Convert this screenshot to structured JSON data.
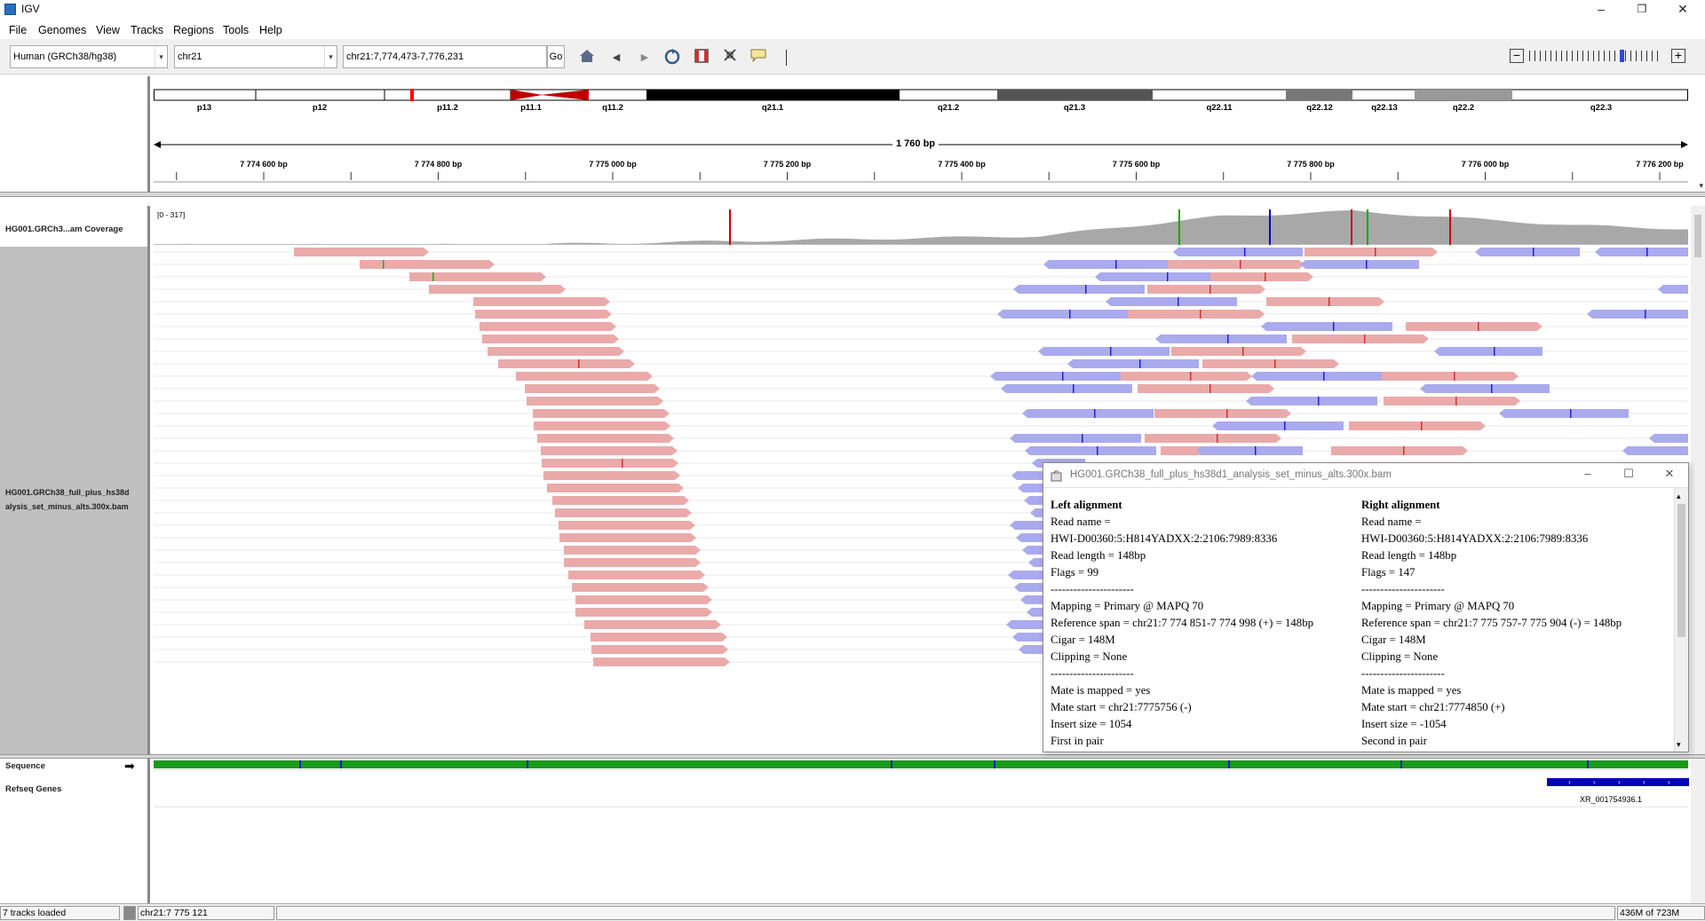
{
  "window": {
    "title": "IGV",
    "minimize": "–",
    "maximize": "❐",
    "close": "✕"
  },
  "menu": [
    "File",
    "Genomes",
    "View",
    "Tracks",
    "Regions",
    "Tools",
    "Help"
  ],
  "toolbar": {
    "genome": "Human (GRCh38/hg38)",
    "chromosome": "chr21",
    "locus": "chr21:7,774,473-7,776,231",
    "go_label": "Go",
    "icons": [
      "home-icon",
      "back-icon",
      "forward-icon",
      "refresh-icon",
      "roi-icon",
      "resize-icon",
      "popup-text-icon"
    ],
    "zoom_out": "−",
    "zoom_in": "+",
    "zoom_level_fraction": 0.68
  },
  "ideogram": {
    "bands": [
      "p13",
      "p12",
      "p11.2",
      "p11.1",
      "q11.2",
      "q21.1",
      "q21.2",
      "q21.3",
      "q22.11",
      "q22.12",
      "q22.13",
      "q22.2",
      "q22.3"
    ]
  },
  "ruler": {
    "span_label": "1 760 bp",
    "ticks": [
      "7 774 600 bp",
      "7 774 800 bp",
      "7 775 000 bp",
      "7 775 200 bp",
      "7 775 400 bp",
      "7 775 600 bp",
      "7 775 800 bp",
      "7 776 000 bp",
      "7 776 200 bp"
    ]
  },
  "tracks": {
    "coverage_name": "HG001.GRCh3...am Coverage",
    "coverage_range": "[0 - 317]",
    "alignment_name_line1": "HG001.GRCh38_full_plus_hs38d",
    "alignment_name_line2": "alysis_set_minus_alts.300x.bam",
    "sequence_name": "Sequence",
    "sequence_arrow": "➡",
    "refseq_name": "Refseq Genes",
    "gene_label": "XR_001754936.1"
  },
  "popup": {
    "title": "HG001.GRCh38_full_plus_hs38d1_analysis_set_minus_alts.300x.bam",
    "left": [
      "Left alignment",
      "Read name =",
      "HWI-D00360:5:H814YADXX:2:2106:7989:8336",
      "Read length = 148bp",
      "Flags = 99",
      "----------------------",
      "Mapping = Primary @ MAPQ 70",
      "Reference span = chr21:7 774 851-7 774 998 (+) = 148bp",
      "Cigar = 148M",
      "Clipping = None",
      "----------------------",
      "Mate is mapped = yes",
      "Mate start = chr21:7775756 (-)",
      "Insert size = 1054",
      "First in pair"
    ],
    "right": [
      "Right alignment",
      "Read name =",
      "HWI-D00360:5:H814YADXX:2:2106:7989:8336",
      "Read length = 148bp",
      "Flags = 147",
      "----------------------",
      "Mapping = Primary @ MAPQ 70",
      "Reference span = chr21:7 775 757-7 775 904 (-) = 148bp",
      "Cigar = 148M",
      "Clipping = None",
      "----------------------",
      "Mate is mapped = yes",
      "Mate start = chr21:7774850 (+)",
      "Insert size = -1054",
      "Second in pair"
    ]
  },
  "status": {
    "tracks_loaded": "7 tracks loaded",
    "position": "chr21:7 775 121",
    "memory": "436M of 723M"
  },
  "colors": {
    "forward_read": "#eaaaaa",
    "reverse_read": "#aaaaee",
    "coverage": "#a8a8a8",
    "name_panel_selected": "#c0c0c0",
    "gene": "#0000b4"
  }
}
